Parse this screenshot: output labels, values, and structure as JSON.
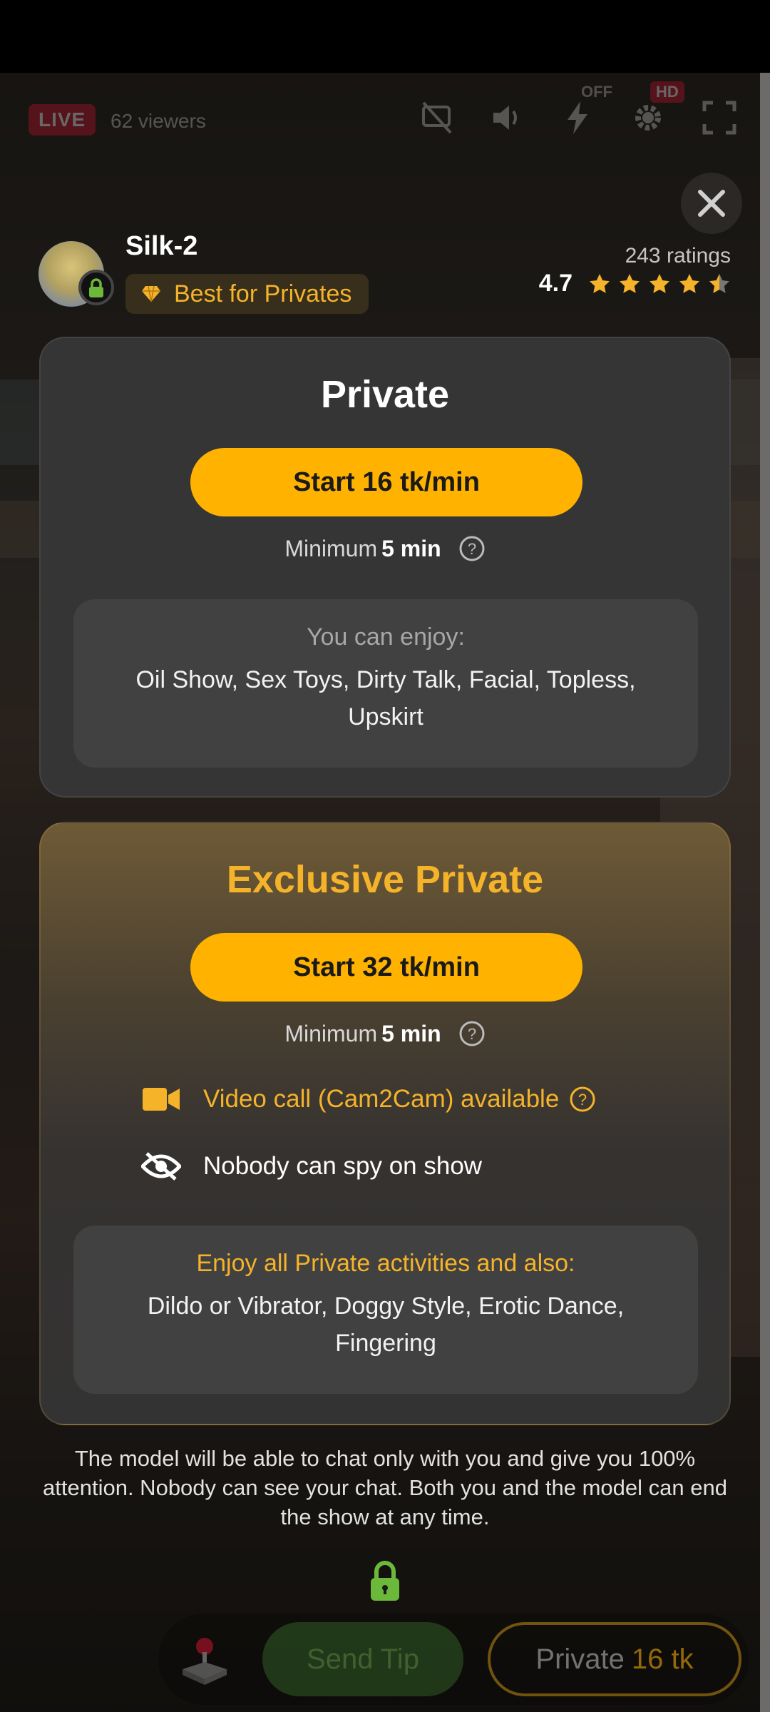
{
  "live": {
    "badge": "LIVE",
    "viewers": "62 viewers",
    "off_label": "OFF",
    "hd_label": "HD"
  },
  "model": {
    "name": "Silk-2",
    "badge": "Best for Privates",
    "ratings_count": "243 ratings",
    "rating": "4.7",
    "stars": 4.5
  },
  "private": {
    "title": "Private",
    "start_label": "Start 16 tk/min",
    "minimum_prefix": "Minimum",
    "minimum_value": "5 min",
    "enjoy_heading": "You can enjoy:",
    "enjoy_list": "Oil Show, Sex Toys, Dirty Talk, Facial, Topless, Upskirt"
  },
  "exclusive": {
    "title": "Exclusive Private",
    "start_label": "Start 32 tk/min",
    "minimum_prefix": "Minimum",
    "minimum_value": "5 min",
    "video_call": "Video call (Cam2Cam) available",
    "no_spy": "Nobody can spy on show",
    "enjoy_heading": "Enjoy all Private activities and also:",
    "enjoy_list": "Dildo or Vibrator, Doggy Style, Erotic Dance, Fingering"
  },
  "footer": {
    "text": "The model will be able to chat only with you and give you 100% attention. Nobody can see your chat. Both you and the model can end the show at any time."
  },
  "bottom_bar": {
    "tip_label": "Send Tip",
    "private_label": "Private",
    "private_price": "16 tk"
  },
  "colors": {
    "accent": "#ffb300",
    "gold_text": "#f5b32a",
    "card_bg": "#353535",
    "lock_green": "#6cb83a"
  }
}
